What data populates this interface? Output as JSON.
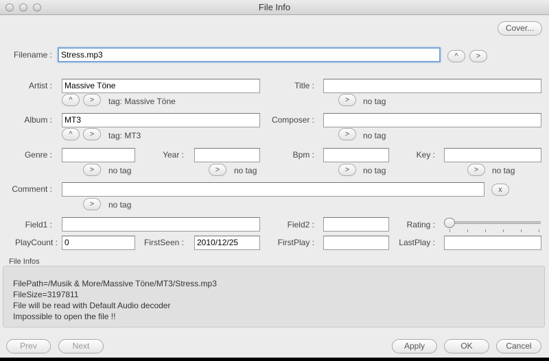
{
  "window": {
    "title": "File Info"
  },
  "cover_button": "Cover...",
  "filename": {
    "label": "Filename :",
    "value": "Stress.mp3",
    "up": "^",
    "next": ">"
  },
  "artist": {
    "label": "Artist :",
    "value": "Massive Töne",
    "up": "^",
    "next": ">",
    "tag": "tag: Massive Töne"
  },
  "title": {
    "label": "Title :",
    "value": "",
    "next": ">",
    "tag": "no tag"
  },
  "album": {
    "label": "Album :",
    "value": "MT3",
    "up": "^",
    "next": ">",
    "tag": "tag: MT3"
  },
  "composer": {
    "label": "Composer :",
    "value": "",
    "next": ">",
    "tag": "no tag"
  },
  "genre": {
    "label": "Genre :",
    "value": "",
    "next": ">",
    "tag": "no tag"
  },
  "year": {
    "label": "Year :",
    "value": "",
    "next": ">",
    "tag": "no tag"
  },
  "bpm": {
    "label": "Bpm :",
    "value": "",
    "next": ">",
    "tag": "no tag"
  },
  "key": {
    "label": "Key :",
    "value": "",
    "next": ">",
    "tag": "no tag"
  },
  "comment": {
    "label": "Comment :",
    "value": "",
    "clear": "x",
    "next": ">",
    "tag": "no tag"
  },
  "field1": {
    "label": "Field1 :",
    "value": ""
  },
  "field2": {
    "label": "Field2 :",
    "value": ""
  },
  "rating": {
    "label": "Rating :",
    "value": 0,
    "max": 5
  },
  "playcount": {
    "label": "PlayCount :",
    "value": "0"
  },
  "firstseen": {
    "label": "FirstSeen :",
    "value": "2010/12/25"
  },
  "firstplay": {
    "label": "FirstPlay :",
    "value": ""
  },
  "lastplay": {
    "label": "LastPlay :",
    "value": ""
  },
  "file_infos": {
    "label": "File Infos",
    "lines": [
      "FilePath=/Musik & More/Massive Töne/MT3/Stress.mp3",
      "FileSize=3197811",
      "File will be read with Default Audio decoder",
      "Impossible to open the file !!"
    ]
  },
  "buttons": {
    "prev": "Prev",
    "next": "Next",
    "apply": "Apply",
    "ok": "OK",
    "cancel": "Cancel"
  }
}
